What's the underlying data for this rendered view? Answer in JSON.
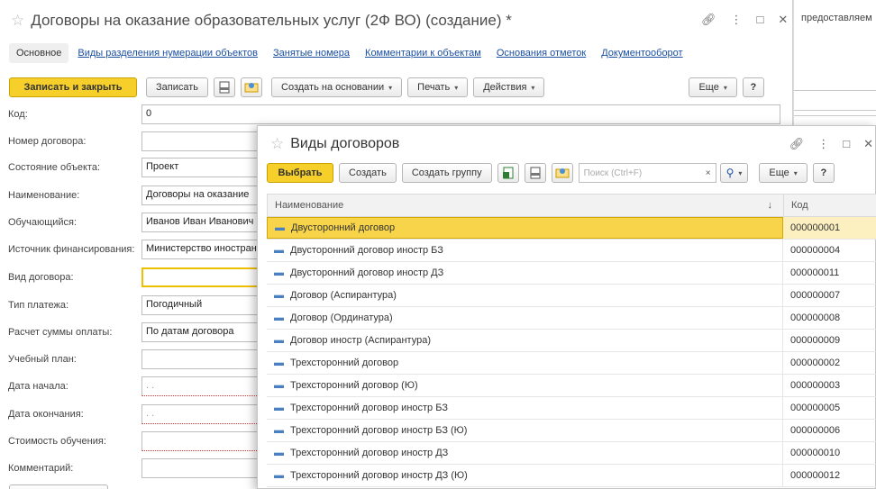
{
  "background": {
    "right_text": "предоставляем"
  },
  "main_window": {
    "title": "Договоры на оказание образовательных услуг (2Ф ВО) (создание) *",
    "tabs": [
      {
        "label": "Основное"
      },
      {
        "label": "Виды разделения нумерации объектов"
      },
      {
        "label": "Занятые номера"
      },
      {
        "label": "Комментарии к объектам"
      },
      {
        "label": "Основания отметок"
      },
      {
        "label": "Документооборот"
      }
    ],
    "toolbar": {
      "save_close": "Записать и закрыть",
      "save": "Записать",
      "create_based": "Создать на основании",
      "print": "Печать",
      "actions": "Действия",
      "more": "Еще",
      "help": "?"
    },
    "fields": [
      {
        "label": "Код:",
        "value": "0"
      },
      {
        "label": "Номер договора:",
        "value": ""
      },
      {
        "label": "Состояние объекта:",
        "value": "Проект"
      },
      {
        "label": "Наименование:",
        "value": "Договоры на оказание"
      },
      {
        "label": "Обучающийся:",
        "value": "Иванов Иван Иванович"
      },
      {
        "label": "Источник финансирования:",
        "value": "Министерство иностран"
      },
      {
        "label": "Вид договора:",
        "value": ""
      },
      {
        "label": "Тип платежа:",
        "value": "Погодичный"
      },
      {
        "label": "Расчет суммы оплаты:",
        "value": "По датам договора"
      },
      {
        "label": "Учебный план:",
        "value": ""
      },
      {
        "label": "Дата начала:",
        "value": ". ."
      },
      {
        "label": "Дата окончания:",
        "value": ". ."
      },
      {
        "label": "Стоимость обучения:",
        "value": ""
      },
      {
        "label": "Комментарий:",
        "value": ""
      }
    ]
  },
  "dialog": {
    "title": "Виды договоров",
    "toolbar": {
      "select": "Выбрать",
      "create": "Создать",
      "create_group": "Создать группу",
      "search_placeholder": "Поиск (Ctrl+F)",
      "search_clear": "×",
      "more": "Еще",
      "help": "?"
    },
    "columns": {
      "name": "Наименование",
      "sort": "↓",
      "code": "Код"
    },
    "rows": [
      {
        "name": "Двусторонний договор",
        "code": "000000001",
        "selected": true
      },
      {
        "name": "Двусторонний договор иностр БЗ",
        "code": "000000004"
      },
      {
        "name": "Двусторонний договор иностр ДЗ",
        "code": "000000011"
      },
      {
        "name": "Договор (Аспирантура)",
        "code": "000000007"
      },
      {
        "name": "Договор (Ординатура)",
        "code": "000000008"
      },
      {
        "name": "Договор иностр (Аспирантура)",
        "code": "000000009"
      },
      {
        "name": "Трехсторонний договор",
        "code": "000000002"
      },
      {
        "name": "Трехсторонний договор (Ю)",
        "code": "000000003"
      },
      {
        "name": "Трехсторонний договор иностр БЗ",
        "code": "000000005"
      },
      {
        "name": "Трехсторонний договор иностр БЗ (Ю)",
        "code": "000000006"
      },
      {
        "name": "Трехсторонний договор иностр ДЗ",
        "code": "000000010"
      },
      {
        "name": "Трехсторонний договор иностр ДЗ (Ю)",
        "code": "000000012"
      }
    ]
  },
  "colors": {
    "accent_yellow": "#f6cf2a",
    "link_blue": "#1b4fa0",
    "selection": "#f7d44a"
  }
}
